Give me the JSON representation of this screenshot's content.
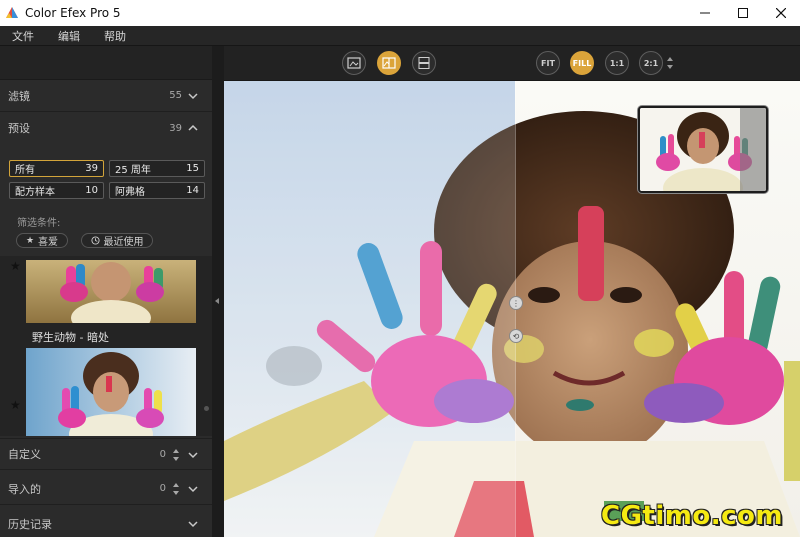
{
  "window": {
    "title": "Color Efex Pro 5"
  },
  "menu": [
    "文件",
    "编辑",
    "帮助"
  ],
  "sidebar": {
    "filters": {
      "label": "滤镜",
      "count": "55"
    },
    "presets": {
      "label": "预设",
      "count": "39"
    },
    "preset_chips": [
      {
        "label": "所有",
        "count": "39",
        "active": true
      },
      {
        "label": "25 周年",
        "count": "15",
        "active": false
      },
      {
        "label": "配方样本",
        "count": "10",
        "active": false
      },
      {
        "label": "阿弗格",
        "count": "14",
        "active": false
      }
    ],
    "filter_label": "筛选条件:",
    "filter_pills": [
      {
        "icon": "star-icon",
        "label": "喜爱"
      },
      {
        "icon": "history-icon",
        "label": "最近使用"
      }
    ],
    "thumbnails": [
      {
        "caption": "野生动物 - 暗处"
      },
      {
        "caption": ""
      }
    ],
    "custom": {
      "label": "自定义",
      "count": "0"
    },
    "imported": {
      "label": "导入的",
      "count": "0"
    },
    "history": {
      "label": "历史记录"
    }
  },
  "toolbar": {
    "view_buttons": [
      "single-view-icon",
      "split-view-icon",
      "side-by-side-icon"
    ],
    "zoom_buttons": [
      "FIT",
      "FILL",
      "1:1",
      "2:1"
    ],
    "active_zoom": "FILL"
  },
  "watermark": "CGtimo.com",
  "colors": {
    "accent": "#dba43a",
    "panel": "#2b2b2b",
    "toolbar": "#222222",
    "watermark": "#f5ea12"
  }
}
